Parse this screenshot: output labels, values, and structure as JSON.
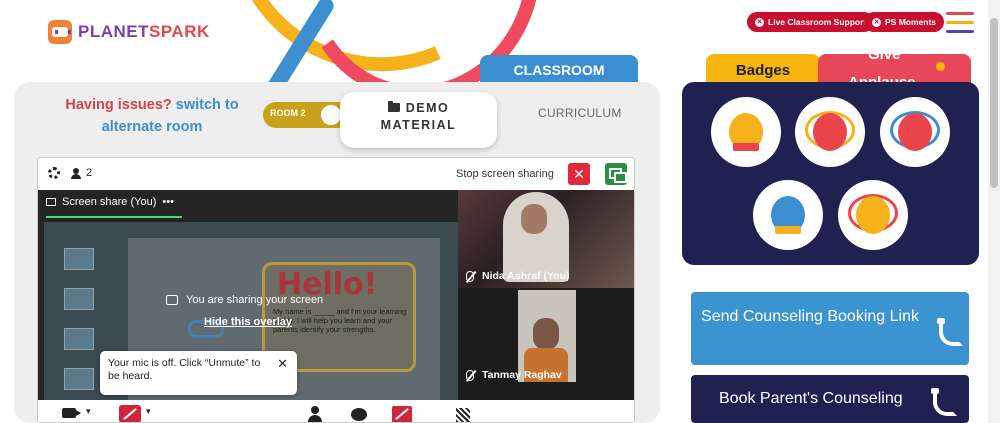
{
  "brand": {
    "planet": "PLANET",
    "spark": "SPARK"
  },
  "header": {
    "live_support": "Live Classroom Support",
    "ps_moments": "PS Moments"
  },
  "classroom": {
    "tab_label": "CLASSROOM",
    "issue_line1": "Having issues?",
    "issue_line1_link": "switch to",
    "issue_line2": "alternate room",
    "room_toggle": "ROOM 2",
    "demo_line1": "DEMO",
    "demo_line2": "MATERIAL",
    "curriculum": "CURRICULUM"
  },
  "zoom": {
    "participant_count": "2",
    "stop_sharing": "Stop screen sharing",
    "share_tab": "Screen share (You)",
    "share_more": "•••",
    "sharing_msg": "You are sharing your screen",
    "hide_overlay": "Hide this overlay",
    "slide_hello": "Hello!",
    "slide_text": "My name is _____ and I'm your learning buddy. I will help you learn and your parents identify your strengths.",
    "participants": [
      {
        "name": "Nida Ashraf (You)"
      },
      {
        "name": "Tanmay Raghav"
      }
    ],
    "mic_tooltip": "Your mic is off. Click “Unmute” to be heard.",
    "close": "✕"
  },
  "right": {
    "tab_badges": "Badges",
    "tab_give": "Give",
    "tab_applause": "Applause",
    "badges": [
      {
        "name": "trophy-badge",
        "color": "#f6b21b"
      },
      {
        "name": "fist-badge",
        "color": "#e8464b"
      },
      {
        "name": "meditation-badge",
        "color": "#e8464b"
      },
      {
        "name": "idea-badge",
        "color": "#3b8fd0"
      },
      {
        "name": "brain-badge",
        "color": "#e8464b"
      }
    ],
    "send_counseling": "Send Counseling Booking Link",
    "book_counseling": "Book Parent's Counseling"
  },
  "colors": {
    "navy": "#1f2251",
    "blue": "#3b93d2",
    "red": "#c8102e",
    "yellow": "#f6b50f"
  }
}
